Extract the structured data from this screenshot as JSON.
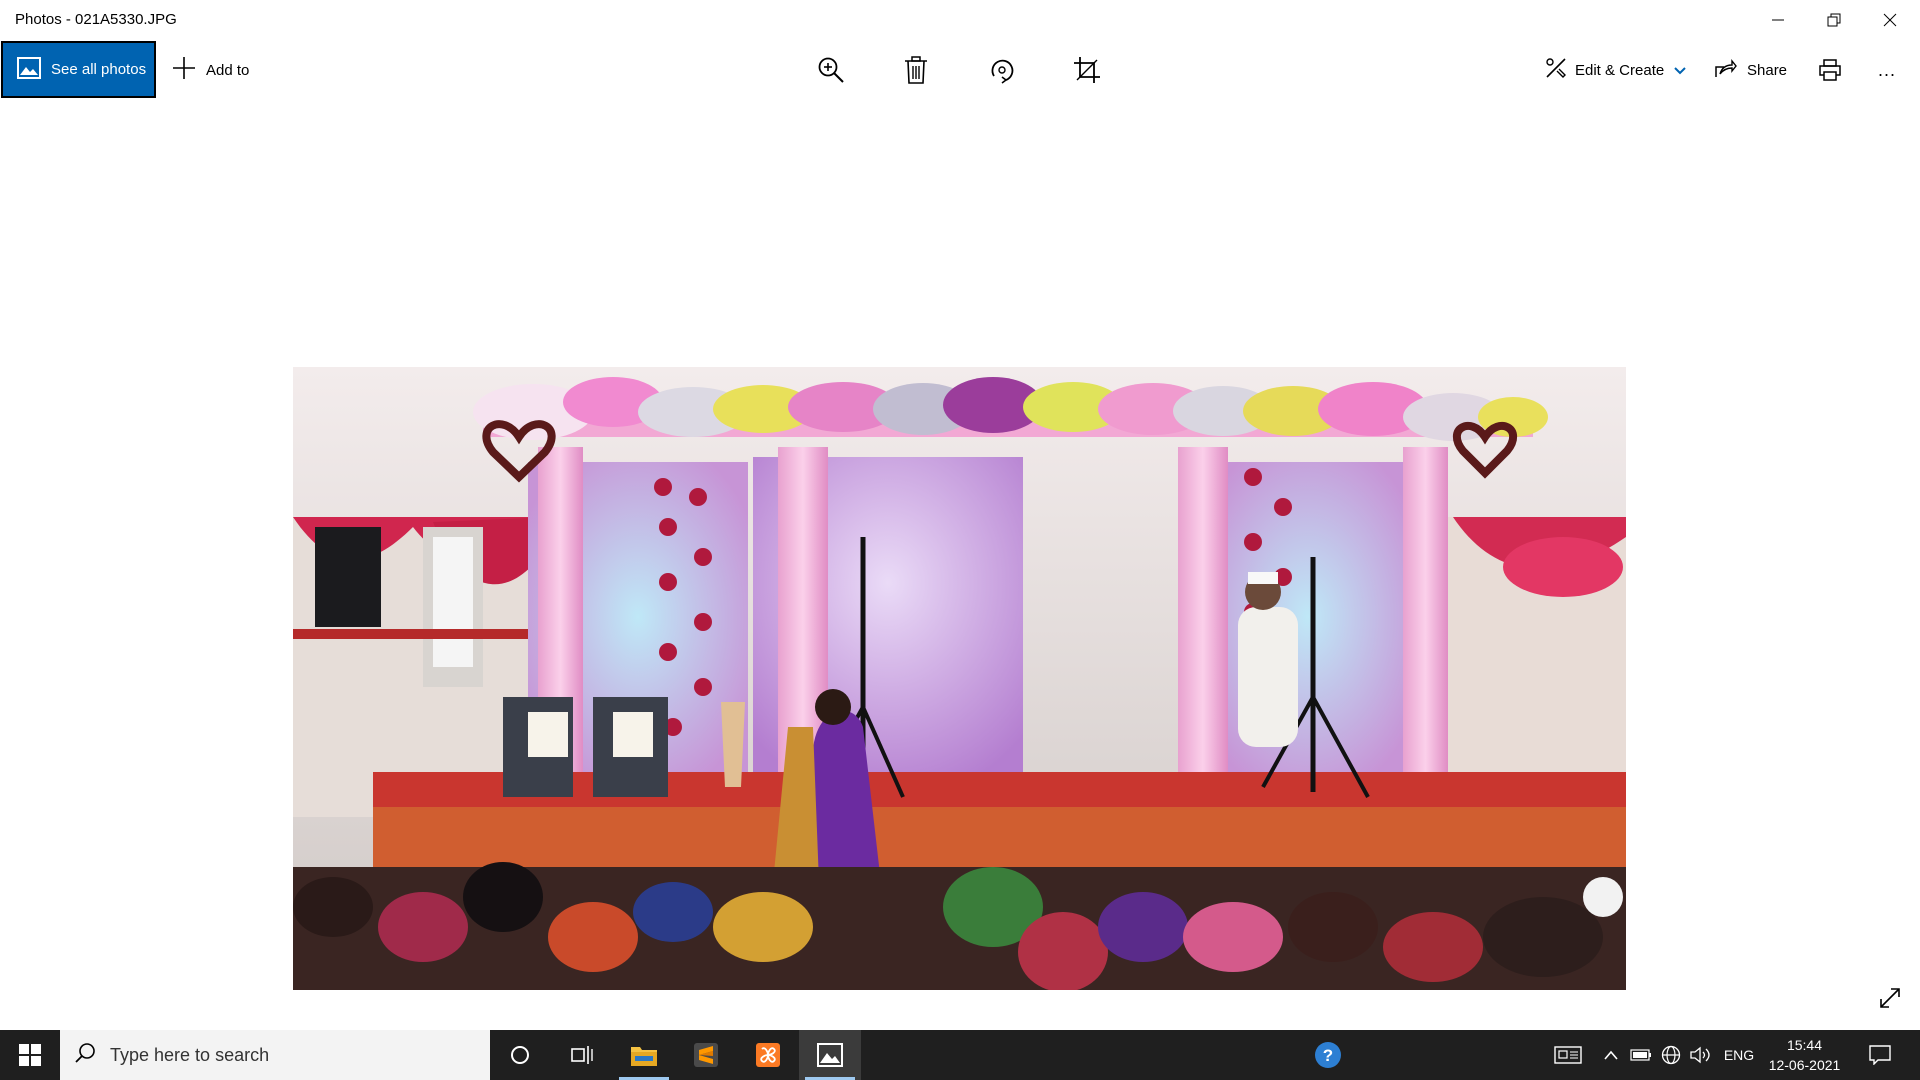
{
  "window": {
    "title": "Photos - 021A5330.JPG"
  },
  "toolbar": {
    "see_all_photos": "See all photos",
    "add_to": "Add to",
    "edit_create": "Edit & Create",
    "share": "Share",
    "more": "..."
  },
  "taskbar": {
    "search_placeholder": "Type here to search",
    "language": "ENG",
    "time": "15:44",
    "date": "12-06-2021"
  },
  "colors": {
    "accent": "#0063b1",
    "taskbar": "#1f1f1f"
  }
}
